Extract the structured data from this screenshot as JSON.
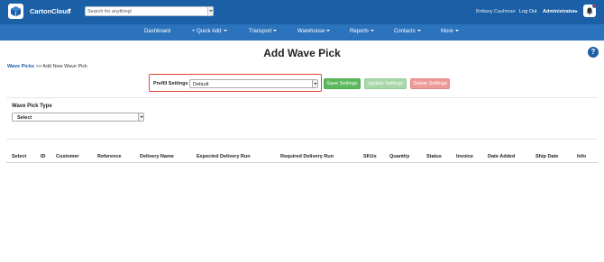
{
  "topbar": {
    "brand": "CartonCloud",
    "search_placeholder": "Search for anything!",
    "user_name": "Brittany Cashman",
    "logout": "Log Out",
    "role": "Administrator"
  },
  "nav": {
    "items": [
      {
        "label": "Dashboard",
        "dropdown": false
      },
      {
        "label": "+ Quick Add",
        "dropdown": true
      },
      {
        "label": "Transport",
        "dropdown": true
      },
      {
        "label": "Warehouse",
        "dropdown": true
      },
      {
        "label": "Reports",
        "dropdown": true
      },
      {
        "label": "Contacts",
        "dropdown": true
      },
      {
        "label": "More",
        "dropdown": true
      }
    ]
  },
  "page": {
    "title": "Add Wave Pick",
    "help": "?",
    "breadcrumb_link": "Wave Picks",
    "breadcrumb_sep": ">>",
    "breadcrumb_current": "Add New Wave Pick"
  },
  "prefill": {
    "label": "Prefill Settings",
    "value": "Default",
    "save": "Save Settings",
    "update": "Update Settings",
    "delete": "Delete Settings"
  },
  "wave_pick_type": {
    "label": "Wave Pick Type",
    "value": "Select"
  },
  "table": {
    "columns": [
      "Select",
      "ID",
      "Customer",
      "Reference",
      "Delivery Name",
      "Expected Delivery Run",
      "Required Delivery Run",
      "SKUs",
      "Quantity",
      "Status",
      "Invoice",
      "Date Added",
      "Ship Date",
      "Info"
    ]
  },
  "colors": {
    "topbar": "#1b5fa6",
    "navbar": "#2c73bd",
    "save": "#5cb85c",
    "update": "#a8d8a8",
    "delete": "#ee9b98",
    "highlight": "#e2443a"
  }
}
